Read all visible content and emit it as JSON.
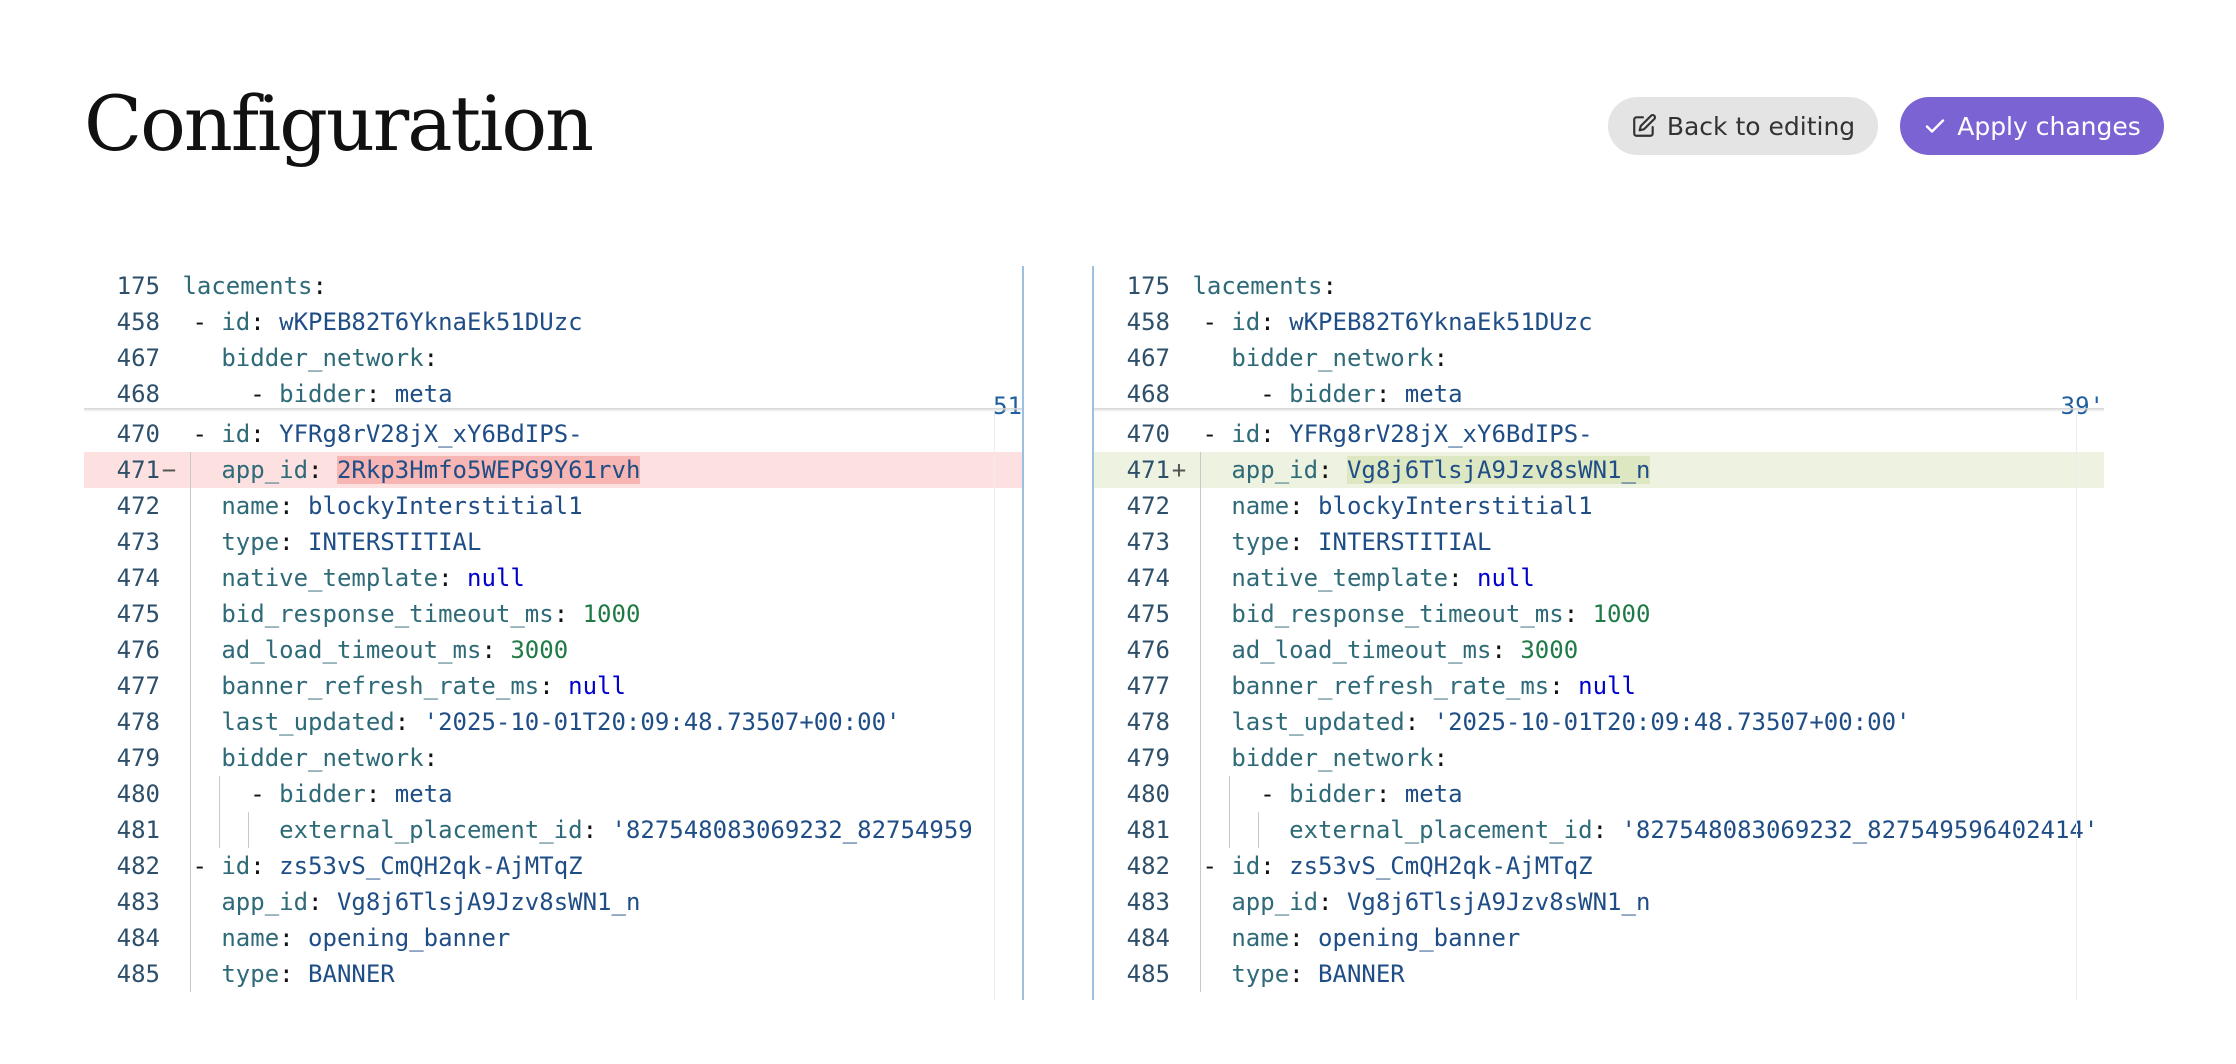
{
  "page": {
    "title": "Configuration"
  },
  "actions": {
    "back_label": "Back to editing",
    "apply_label": "Apply changes",
    "back_icon": "edit-icon",
    "apply_icon": "check-icon"
  },
  "colors": {
    "accent": "#7b63d3",
    "removed_line": "#fde1e0",
    "removed_highlight": "#f7b6b3",
    "added_line": "#eef3e1",
    "added_highlight": "#dde8c3"
  },
  "diff": {
    "left": {
      "sticky_header": [
        {
          "num": "175",
          "key": "placements",
          "value": ""
        },
        {
          "num": "458",
          "key": "id",
          "value": "wKPEB82T6YknaEk51DUzc",
          "dash": true
        },
        {
          "num": "467",
          "key": "bidder_network",
          "value": ""
        },
        {
          "num": "468",
          "key": "bidder",
          "value": "meta",
          "dash": true
        }
      ],
      "sticky_ghost": "51",
      "lines": [
        {
          "num": "470",
          "key": "id",
          "value": "YFRg8rV28jX_xY6BdIPS-",
          "dash": true
        },
        {
          "num": "471",
          "marker": "−",
          "key": "app_id",
          "value": "2Rkp3Hmfo5WEPG9Y61rvh",
          "change": "removed"
        },
        {
          "num": "472",
          "key": "name",
          "value": "blockyInterstitial1"
        },
        {
          "num": "473",
          "key": "type",
          "value": "INTERSTITIAL"
        },
        {
          "num": "474",
          "key": "native_template",
          "value": "null"
        },
        {
          "num": "475",
          "key": "bid_response_timeout_ms",
          "value": "1000"
        },
        {
          "num": "476",
          "key": "ad_load_timeout_ms",
          "value": "3000"
        },
        {
          "num": "477",
          "key": "banner_refresh_rate_ms",
          "value": "null"
        },
        {
          "num": "478",
          "key": "last_updated",
          "value": "'2025-10-01T20:09:48.73507+00:00'"
        },
        {
          "num": "479",
          "key": "bidder_network",
          "value": ""
        },
        {
          "num": "480",
          "key": "bidder",
          "value": "meta",
          "dash": true
        },
        {
          "num": "481",
          "key": "external_placement_id",
          "value": "'827548083069232_82754959"
        },
        {
          "num": "482",
          "key": "id",
          "value": "zs53vS_CmQH2qk-AjMTqZ",
          "dash": true
        },
        {
          "num": "483",
          "key": "app_id",
          "value": "Vg8j6TlsjA9Jzv8sWN1_n"
        },
        {
          "num": "484",
          "key": "name",
          "value": "opening_banner"
        },
        {
          "num": "485",
          "key": "type",
          "value": "BANNER"
        }
      ]
    },
    "right": {
      "sticky_header": [
        {
          "num": "175",
          "key": "placements",
          "value": ""
        },
        {
          "num": "458",
          "key": "id",
          "value": "wKPEB82T6YknaEk51DUzc",
          "dash": true
        },
        {
          "num": "467",
          "key": "bidder_network",
          "value": ""
        },
        {
          "num": "468",
          "key": "bidder",
          "value": "meta",
          "dash": true
        }
      ],
      "sticky_ghost": "39'",
      "lines": [
        {
          "num": "470",
          "key": "id",
          "value": "YFRg8rV28jX_xY6BdIPS-",
          "dash": true
        },
        {
          "num": "471",
          "marker": "+",
          "key": "app_id",
          "value": "Vg8j6TlsjA9Jzv8sWN1_n",
          "change": "added"
        },
        {
          "num": "472",
          "key": "name",
          "value": "blockyInterstitial1"
        },
        {
          "num": "473",
          "key": "type",
          "value": "INTERSTITIAL"
        },
        {
          "num": "474",
          "key": "native_template",
          "value": "null"
        },
        {
          "num": "475",
          "key": "bid_response_timeout_ms",
          "value": "1000"
        },
        {
          "num": "476",
          "key": "ad_load_timeout_ms",
          "value": "3000"
        },
        {
          "num": "477",
          "key": "banner_refresh_rate_ms",
          "value": "null"
        },
        {
          "num": "478",
          "key": "last_updated",
          "value": "'2025-10-01T20:09:48.73507+00:00'"
        },
        {
          "num": "479",
          "key": "bidder_network",
          "value": ""
        },
        {
          "num": "480",
          "key": "bidder",
          "value": "meta",
          "dash": true
        },
        {
          "num": "481",
          "key": "external_placement_id",
          "value": "'827548083069232_827549596402414'"
        },
        {
          "num": "482",
          "key": "id",
          "value": "zs53vS_CmQH2qk-AjMTqZ",
          "dash": true
        },
        {
          "num": "483",
          "key": "app_id",
          "value": "Vg8j6TlsjA9Jzv8sWN1_n"
        },
        {
          "num": "484",
          "key": "name",
          "value": "opening_banner"
        },
        {
          "num": "485",
          "key": "type",
          "value": "BANNER"
        }
      ]
    }
  }
}
